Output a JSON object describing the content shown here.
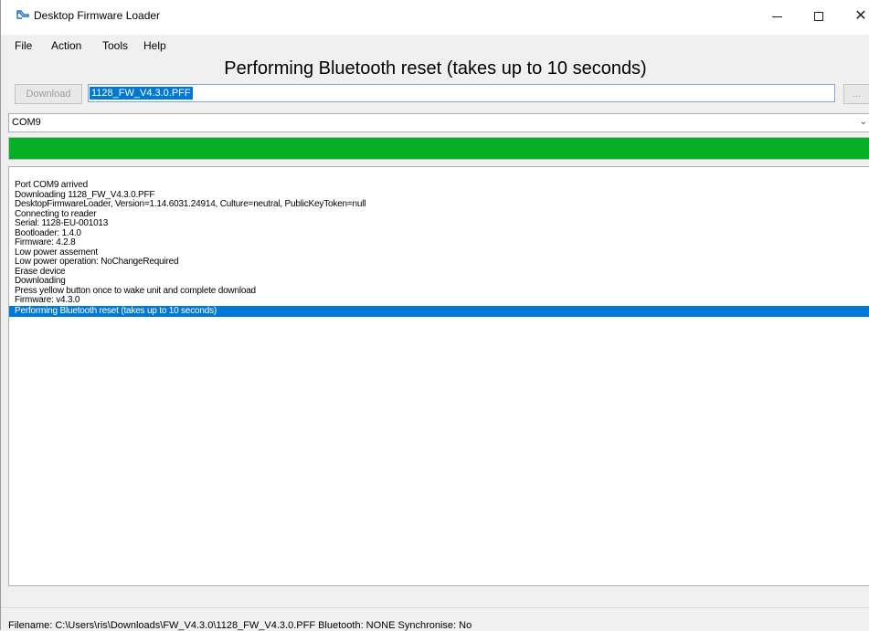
{
  "window": {
    "title": "Desktop Firmware Loader",
    "controls": {
      "minimize": "—",
      "maximize": "□",
      "close": "✕"
    },
    "icon": "app-icon"
  },
  "menu": {
    "items": [
      "File",
      "Action",
      "Tools",
      "Help"
    ]
  },
  "headline": "Performing Bluetooth reset (takes up to 10 seconds)",
  "download": {
    "button_label": "Download",
    "filename": "1128_FW_V4.3.0.PFF",
    "browse_label": "..."
  },
  "port": {
    "value": "COM9"
  },
  "progress": {
    "fraction": 1.0,
    "color": "#06b025"
  },
  "log": {
    "lines": [
      "Port COM9 arrived",
      "Downloading 1128_FW_V4.3.0.PFF",
      "DesktopFirmwareLoader, Version=1.14.6031.24914, Culture=neutral, PublicKeyToken=null",
      "Connecting to reader",
      "Serial: 1128-EU-001013",
      "Bootloader: 1.4.0",
      "Firmware: 4.2.8",
      "Low power assement",
      "Low power operation: NoChangeRequired",
      "Erase device",
      "Downloading",
      "Press yellow button once to wake unit and complete download",
      "Firmware: v4.3.0",
      "Performing Bluetooth reset (takes up to 10 seconds)"
    ],
    "selected_index": 13
  },
  "status": {
    "text": "Filename: C:\\Users\\ris\\Downloads\\FW_V4.3.0\\1128_FW_V4.3.0.PFF  Bluetooth: NONE  Synchronise: No"
  },
  "colors": {
    "selection": "#0078d7",
    "progress": "#06b025"
  }
}
